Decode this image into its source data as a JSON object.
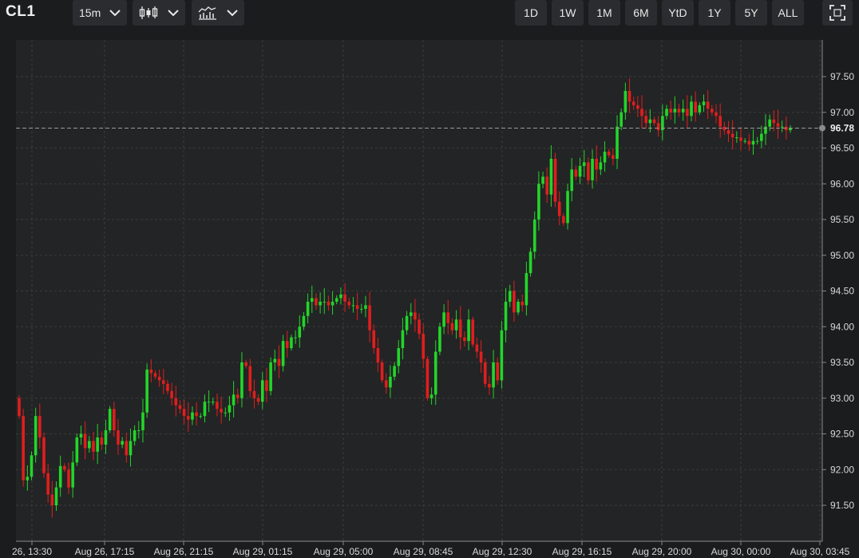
{
  "toolbar": {
    "symbol": "CL1",
    "interval": "15m",
    "chart_type_icon": "candlestick-icon",
    "study_icon": "indicator-chart-icon",
    "ranges": [
      "1D",
      "1W",
      "1M",
      "6M",
      "YtD",
      "1Y",
      "5Y",
      "ALL"
    ],
    "fullscreen_icon": "fullscreen-icon"
  },
  "sidebar": {
    "tools": [
      "drawing-tool-icon",
      "line-tool-icon",
      "horizontal-line-icon",
      "fib-tool-icon",
      "pitchfork-icon",
      "brush-icon",
      "measure-icon",
      "text-tool-icon",
      "magnet-icon",
      "eraser-icon"
    ]
  },
  "colors": {
    "background": "#232425",
    "up": "#22d62a",
    "down": "#e01e1e",
    "grid": "#3a3b3d",
    "axis_text": "#d8d8d8"
  },
  "chart_data": {
    "type": "candlestick",
    "symbol": "CL1",
    "last_price": 96.78,
    "last_price_label": "96.78",
    "ylim": [
      91.0,
      97.95
    ],
    "y_ticks": [
      91.5,
      92.0,
      92.5,
      93.0,
      93.5,
      94.0,
      94.5,
      95.0,
      95.5,
      96.0,
      96.5,
      97.0,
      97.5
    ],
    "y_tick_labels": [
      "91.50",
      "92.00",
      "92.50",
      "93.00",
      "93.50",
      "94.00",
      "94.50",
      "95.00",
      "95.50",
      "96.00",
      "96.50",
      "97.00",
      "97.50"
    ],
    "x_tick_labels": [
      "26, 13:30",
      "Aug 26, 17:15",
      "Aug 26, 21:15",
      "Aug 29, 01:15",
      "Aug 29, 05:00",
      "Aug 29, 08:45",
      "Aug 29, 12:30",
      "Aug 29, 16:15",
      "Aug 29, 20:00",
      "Aug 30, 00:00",
      "Aug 30, 03:45"
    ],
    "grid": true,
    "close": [
      92.75,
      91.85,
      91.9,
      92.2,
      92.75,
      92.45,
      91.95,
      91.65,
      91.5,
      91.75,
      92.05,
      92.0,
      91.75,
      92.1,
      92.45,
      92.5,
      92.3,
      92.4,
      92.25,
      92.45,
      92.35,
      92.55,
      92.85,
      92.55,
      92.35,
      92.4,
      92.2,
      92.4,
      92.55,
      92.55,
      92.8,
      93.4,
      93.35,
      93.3,
      93.25,
      93.2,
      93.1,
      93.0,
      92.9,
      92.85,
      92.75,
      92.7,
      92.8,
      92.75,
      92.75,
      92.95,
      92.95,
      92.95,
      92.85,
      92.8,
      92.8,
      92.9,
      93.05,
      93.0,
      93.5,
      93.45,
      93.1,
      93.0,
      92.95,
      93.25,
      93.1,
      93.5,
      93.55,
      93.45,
      93.8,
      93.7,
      93.85,
      93.85,
      94.0,
      94.15,
      94.35,
      94.4,
      94.3,
      94.35,
      94.35,
      94.3,
      94.35,
      94.4,
      94.45,
      94.35,
      94.3,
      94.3,
      94.25,
      94.25,
      94.3,
      93.95,
      93.7,
      93.5,
      93.25,
      93.15,
      93.3,
      93.45,
      93.7,
      93.95,
      94.15,
      94.2,
      94.1,
      93.9,
      93.55,
      93.0,
      93.05,
      93.65,
      94.0,
      94.2,
      94.05,
      93.95,
      94.1,
      93.85,
      93.8,
      94.1,
      93.75,
      93.65,
      93.5,
      93.2,
      93.15,
      93.5,
      93.25,
      93.95,
      94.35,
      94.5,
      94.2,
      94.35,
      94.3,
      94.75,
      95.05,
      95.5,
      96.0,
      96.1,
      95.85,
      96.35,
      95.75,
      95.55,
      95.45,
      95.9,
      96.2,
      96.1,
      96.25,
      96.3,
      96.05,
      96.35,
      96.2,
      96.3,
      96.45,
      96.4,
      96.35,
      96.8,
      97.0,
      97.3,
      97.15,
      97.1,
      97.05,
      96.95,
      96.85,
      96.9,
      96.85,
      96.75,
      96.95,
      97.05,
      97.0,
      97.05,
      97.0,
      97.05,
      96.95,
      97.15,
      97.0,
      97.1,
      97.15,
      97.05,
      97.0,
      96.95,
      96.8,
      96.75,
      96.7,
      96.65,
      96.65,
      96.6,
      96.6,
      96.55,
      96.6,
      96.6,
      96.7,
      96.8,
      96.9,
      96.85,
      96.8,
      96.8,
      96.75,
      96.78
    ],
    "candle_count": 193
  }
}
